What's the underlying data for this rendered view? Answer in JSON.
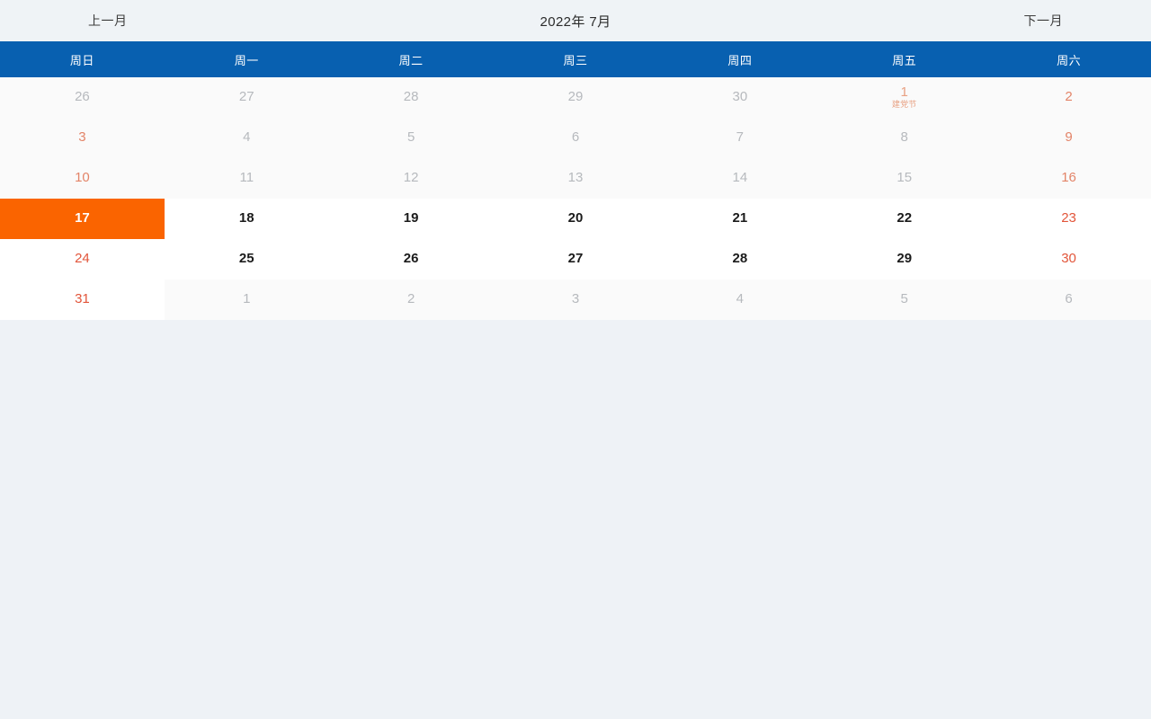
{
  "toolbar": {
    "prev_label": "上一月",
    "next_label": "下一月",
    "title": "2022年 7月"
  },
  "weekdays": [
    {
      "label": "周日"
    },
    {
      "label": "周一"
    },
    {
      "label": "周二"
    },
    {
      "label": "周三"
    },
    {
      "label": "周四"
    },
    {
      "label": "周五"
    },
    {
      "label": "周六"
    }
  ],
  "colors": {
    "header_blue": "#0860b0",
    "selected_orange": "#fa6400",
    "weekend_red": "#e2553a",
    "holiday_orange": "#e8a183",
    "page_background": "#eef2f6",
    "past_cell": "#fafafa",
    "current_cell": "#ffffff"
  },
  "weeks": [
    {
      "days": [
        {
          "num": "26",
          "month": "prev",
          "state": "past",
          "weekend": true,
          "holiday": ""
        },
        {
          "num": "27",
          "month": "prev",
          "state": "past",
          "weekend": false,
          "holiday": ""
        },
        {
          "num": "28",
          "month": "prev",
          "state": "past",
          "weekend": false,
          "holiday": ""
        },
        {
          "num": "29",
          "month": "prev",
          "state": "past",
          "weekend": false,
          "holiday": ""
        },
        {
          "num": "30",
          "month": "prev",
          "state": "past",
          "weekend": false,
          "holiday": ""
        },
        {
          "num": "1",
          "month": "current",
          "state": "past",
          "weekend": false,
          "holiday": "建党节"
        },
        {
          "num": "2",
          "month": "current",
          "state": "past",
          "weekend": true,
          "holiday": ""
        }
      ]
    },
    {
      "days": [
        {
          "num": "3",
          "month": "current",
          "state": "past",
          "weekend": true,
          "holiday": ""
        },
        {
          "num": "4",
          "month": "current",
          "state": "past",
          "weekend": false,
          "holiday": ""
        },
        {
          "num": "5",
          "month": "current",
          "state": "past",
          "weekend": false,
          "holiday": ""
        },
        {
          "num": "6",
          "month": "current",
          "state": "past",
          "weekend": false,
          "holiday": ""
        },
        {
          "num": "7",
          "month": "current",
          "state": "past",
          "weekend": false,
          "holiday": ""
        },
        {
          "num": "8",
          "month": "current",
          "state": "past",
          "weekend": false,
          "holiday": ""
        },
        {
          "num": "9",
          "month": "current",
          "state": "past",
          "weekend": true,
          "holiday": ""
        }
      ]
    },
    {
      "days": [
        {
          "num": "10",
          "month": "current",
          "state": "past",
          "weekend": true,
          "holiday": ""
        },
        {
          "num": "11",
          "month": "current",
          "state": "past",
          "weekend": false,
          "holiday": ""
        },
        {
          "num": "12",
          "month": "current",
          "state": "past",
          "weekend": false,
          "holiday": ""
        },
        {
          "num": "13",
          "month": "current",
          "state": "past",
          "weekend": false,
          "holiday": ""
        },
        {
          "num": "14",
          "month": "current",
          "state": "past",
          "weekend": false,
          "holiday": ""
        },
        {
          "num": "15",
          "month": "current",
          "state": "past",
          "weekend": false,
          "holiday": ""
        },
        {
          "num": "16",
          "month": "current",
          "state": "past",
          "weekend": true,
          "holiday": ""
        }
      ]
    },
    {
      "days": [
        {
          "num": "17",
          "month": "current",
          "state": "selected",
          "weekend": true,
          "holiday": ""
        },
        {
          "num": "18",
          "month": "current",
          "state": "normal",
          "weekend": false,
          "holiday": ""
        },
        {
          "num": "19",
          "month": "current",
          "state": "normal",
          "weekend": false,
          "holiday": ""
        },
        {
          "num": "20",
          "month": "current",
          "state": "normal",
          "weekend": false,
          "holiday": ""
        },
        {
          "num": "21",
          "month": "current",
          "state": "normal",
          "weekend": false,
          "holiday": ""
        },
        {
          "num": "22",
          "month": "current",
          "state": "normal",
          "weekend": false,
          "holiday": ""
        },
        {
          "num": "23",
          "month": "current",
          "state": "normal",
          "weekend": true,
          "holiday": ""
        }
      ]
    },
    {
      "days": [
        {
          "num": "24",
          "month": "current",
          "state": "normal",
          "weekend": true,
          "holiday": ""
        },
        {
          "num": "25",
          "month": "current",
          "state": "normal",
          "weekend": false,
          "holiday": ""
        },
        {
          "num": "26",
          "month": "current",
          "state": "normal",
          "weekend": false,
          "holiday": ""
        },
        {
          "num": "27",
          "month": "current",
          "state": "normal",
          "weekend": false,
          "holiday": ""
        },
        {
          "num": "28",
          "month": "current",
          "state": "normal",
          "weekend": false,
          "holiday": ""
        },
        {
          "num": "29",
          "month": "current",
          "state": "normal",
          "weekend": false,
          "holiday": ""
        },
        {
          "num": "30",
          "month": "current",
          "state": "normal",
          "weekend": true,
          "holiday": ""
        }
      ]
    },
    {
      "days": [
        {
          "num": "31",
          "month": "current",
          "state": "normal",
          "weekend": true,
          "holiday": ""
        },
        {
          "num": "1",
          "month": "next",
          "state": "normal",
          "weekend": false,
          "holiday": ""
        },
        {
          "num": "2",
          "month": "next",
          "state": "normal",
          "weekend": false,
          "holiday": ""
        },
        {
          "num": "3",
          "month": "next",
          "state": "normal",
          "weekend": false,
          "holiday": ""
        },
        {
          "num": "4",
          "month": "next",
          "state": "normal",
          "weekend": false,
          "holiday": ""
        },
        {
          "num": "5",
          "month": "next",
          "state": "normal",
          "weekend": false,
          "holiday": ""
        },
        {
          "num": "6",
          "month": "next",
          "state": "normal",
          "weekend": true,
          "holiday": ""
        }
      ]
    }
  ]
}
